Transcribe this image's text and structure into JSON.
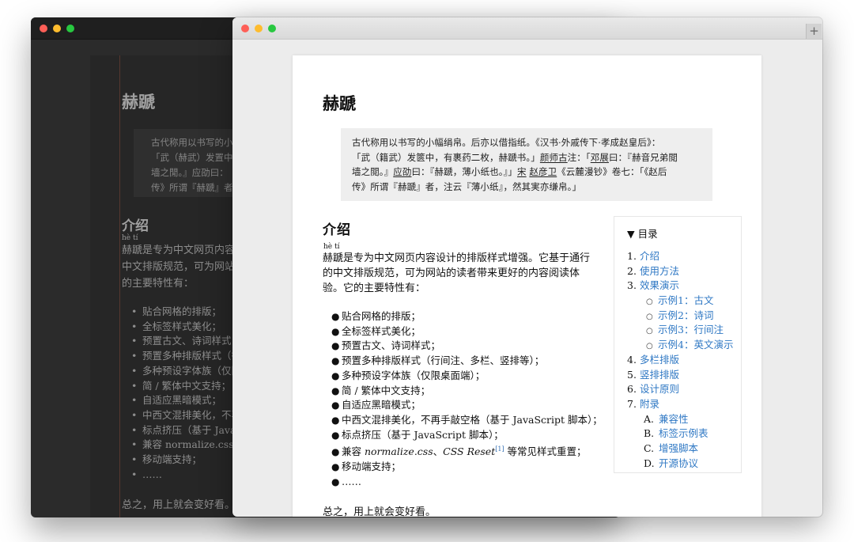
{
  "dark_window": {
    "title": "赫蹏",
    "quote_lines": [
      "古代称用以书写的小",
      "「武（赫武）发置中，",
      "墙之閒。』应劭曰：",
      "传》所谓『赫蹏』者"
    ],
    "intro_heading": "介绍",
    "ruby": "hè tí",
    "intro_lines": [
      "赫蹏是专为中文网页内容",
      "中文排版规范，可为网站",
      "的主要特性有："
    ],
    "features": [
      "贴合网格的排版；",
      "全标签样式美化；",
      "预置古文、诗词样式；",
      "预置多种排版样式（行",
      "多种预设字体族（仅限",
      "简 / 繁体中文支持；",
      "自适应黑暗模式；",
      "中西文混排美化，不再",
      "标点挤压（基于 JavaS",
      "兼容 normalize.css、C",
      "移动端支持；",
      "……"
    ],
    "summary": "总之，用上就会变好看。"
  },
  "light_window": {
    "title": "赫蹏",
    "quote": {
      "line1": "古代称用以书写的小幅绢帛。后亦以借指纸。《汉书·外戚传下·孝成赵皇后》：",
      "line2_a": "「武（籍武）发篋中，有裹药二枚，赫蹏书。」",
      "line2_b": "颜师古",
      "line2_c": "注：「",
      "line2_d": "邓展",
      "line2_e": "曰：『赫音兄弟閲",
      "line3_a": "墙之閲。』",
      "line3_b": "应劭",
      "line3_c": "曰：『赫蹏，薄小纸也。』」",
      "line3_d": "宋",
      "line3_e": "赵彦卫",
      "line3_f": "《云麓漫钞》卷七：「《赵后",
      "line4": "传》所谓『赫蹏』者，注云『薄小纸』，然其実亦缣帛。」"
    },
    "intro": {
      "heading": "介绍",
      "ruby": "hè tí",
      "para": "赫蹏是专为中文网页内容设计的排版样式增强。它基于通行的中文排版规范，可为网站的读者带来更好的内容阅读体验。它的主要特性有：",
      "features": [
        "贴合网格的排版；",
        "全标签样式美化；",
        "预置古文、诗词样式；",
        "预置多种排版样式（行间注、多栏、竖排等）；",
        "多种预设字体族（仅限桌面端）；",
        "简 / 繁体中文支持；",
        "自适应黑暗模式；",
        "中西文混排美化，不再手敲空格（基于 JavaScript 脚本）；",
        "标点挤压（基于 JavaScript 脚本）；"
      ],
      "compat_prefix": "兼容 ",
      "compat_italic1": "normalize.css",
      "compat_sep": "、",
      "compat_italic2": "CSS Reset",
      "compat_sup": "[1]",
      "compat_suffix": " 等常见样式重置；",
      "features_tail": [
        "移动端支持；",
        "……"
      ],
      "summary": "总之，用上就会变好看。"
    },
    "toc": {
      "heading": "▼ 目录",
      "items": [
        {
          "num": "1.",
          "label": "介绍"
        },
        {
          "num": "2.",
          "label": "使用方法"
        },
        {
          "num": "3.",
          "label": "效果演示"
        }
      ],
      "sub_items": [
        "示例1：古文",
        "示例2：诗词",
        "示例3：行间注",
        "示例4：英文演示"
      ],
      "items_after": [
        {
          "num": "4.",
          "label": "多栏排版"
        },
        {
          "num": "5.",
          "label": "竖排排版"
        },
        {
          "num": "6.",
          "label": "设计原则"
        },
        {
          "num": "7.",
          "label": "附录"
        }
      ],
      "appendix": [
        {
          "num": "A.",
          "label": "兼容性"
        },
        {
          "num": "B.",
          "label": "标签示例表"
        },
        {
          "num": "C.",
          "label": "增强脚本"
        },
        {
          "num": "D.",
          "label": "开源协议"
        }
      ]
    },
    "new_tab_symbol": "+"
  },
  "colors": {
    "link": "#2f78c4",
    "dark_bg": "#2b2b2b",
    "quote_bg": "#eeeeee"
  }
}
